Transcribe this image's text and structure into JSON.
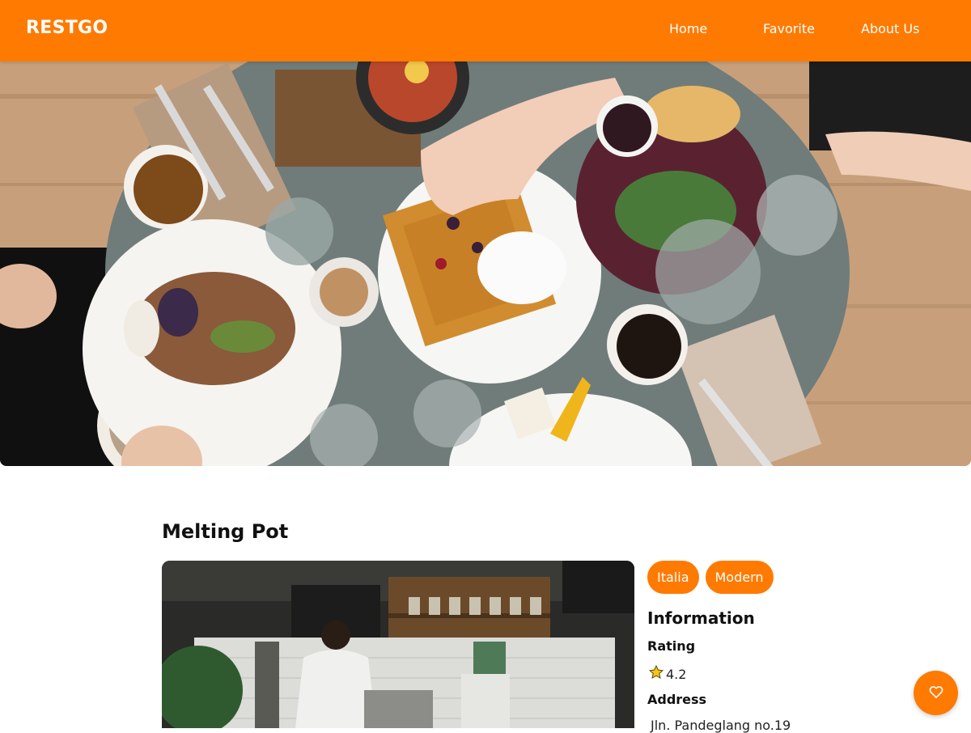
{
  "header": {
    "brand": "RESTGO",
    "nav": {
      "home": "Home",
      "favorite": "Favorite",
      "about": "About Us"
    }
  },
  "restaurant": {
    "name": "Melting Pot",
    "tags": [
      "Italia",
      "Modern"
    ],
    "information_title": "Information",
    "rating_label": "Rating",
    "rating_value": "4.2",
    "address_label": "Address",
    "address_value": "Jln. Pandeglang no.19"
  },
  "icons": {
    "hero": "food-table-photo",
    "photo": "cafe-interior-photo",
    "star": "star-icon",
    "fab": "heart-icon"
  },
  "colors": {
    "accent": "#ff7a00",
    "text": "#111111",
    "background": "#ffffff"
  }
}
